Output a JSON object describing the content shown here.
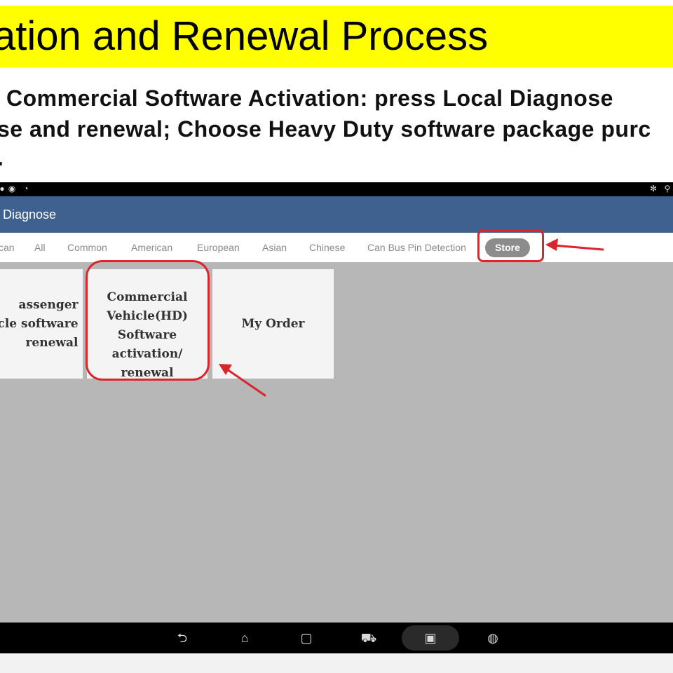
{
  "slide": {
    "title": "ation and Renewal Process",
    "instructions": [
      "Commercial Software Activation: press Local Diagnose",
      "se and renewal; Choose Heavy Duty software package purc",
      "."
    ]
  },
  "status_bar": {
    "icons": [
      "notification-icon",
      "sync-icon",
      "clock-icon",
      "settings-icon",
      "location-icon"
    ]
  },
  "app_bar": {
    "title": "Diagnose"
  },
  "tabs": [
    "can",
    "All",
    "Common",
    "American",
    "European",
    "Asian",
    "Chinese",
    "Can Bus Pin Detection",
    "Store"
  ],
  "cards": [
    {
      "label": "assenger\ncle software\nrenewal"
    },
    {
      "label": "Commercial\nVehicle(HD)\nSoftware\nactivation/\nrenewal"
    },
    {
      "label": "My Order"
    }
  ],
  "nav_bar": {
    "icons": [
      "back-icon",
      "home-icon",
      "recents-icon",
      "vci-icon",
      "screenshot-icon",
      "browser-icon"
    ]
  },
  "colors": {
    "title_bg": "#ffff00",
    "app_bar": "#3f6190",
    "annotation": "#d9252b",
    "content_bg": "#b7b7b7"
  }
}
